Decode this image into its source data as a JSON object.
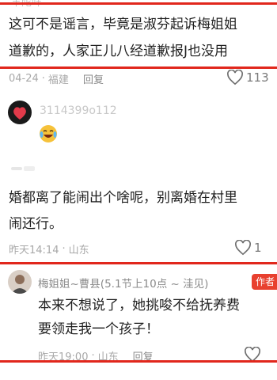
{
  "top_partial_name": "羊陀咩",
  "comment1": {
    "lines": [
      "这可不是谣言，毕竟是淑芬起诉梅姐姐",
      "道歉的，人家正儿八经道歉报J也没用"
    ],
    "date": "04-24",
    "location": "福建",
    "reply_label": "回复",
    "likes": "113"
  },
  "comment2": {
    "username": "3114399o112",
    "emoji": "laughing-crying-emoji"
  },
  "comment3": {
    "lines": [
      "婚都离了能闹出个啥呢，别离婚在村里",
      "闹还行。"
    ],
    "date": "昨天14:14",
    "location": "山东",
    "likes": "1"
  },
  "comment4": {
    "username": "梅姐姐~曹县(5.1节上10点 ~ 洼见)",
    "author_badge": "作者",
    "lines": [
      "本来不想说了，她挑唆不给抚养费",
      "要领走我一个孩子！"
    ],
    "date": "昨天19:00",
    "location": "山东",
    "reply_label": "回复"
  },
  "colors": {
    "highlight_red": "#e1271c",
    "author_badge": "#e8402f",
    "meta_gray": "#a8a8a8"
  }
}
